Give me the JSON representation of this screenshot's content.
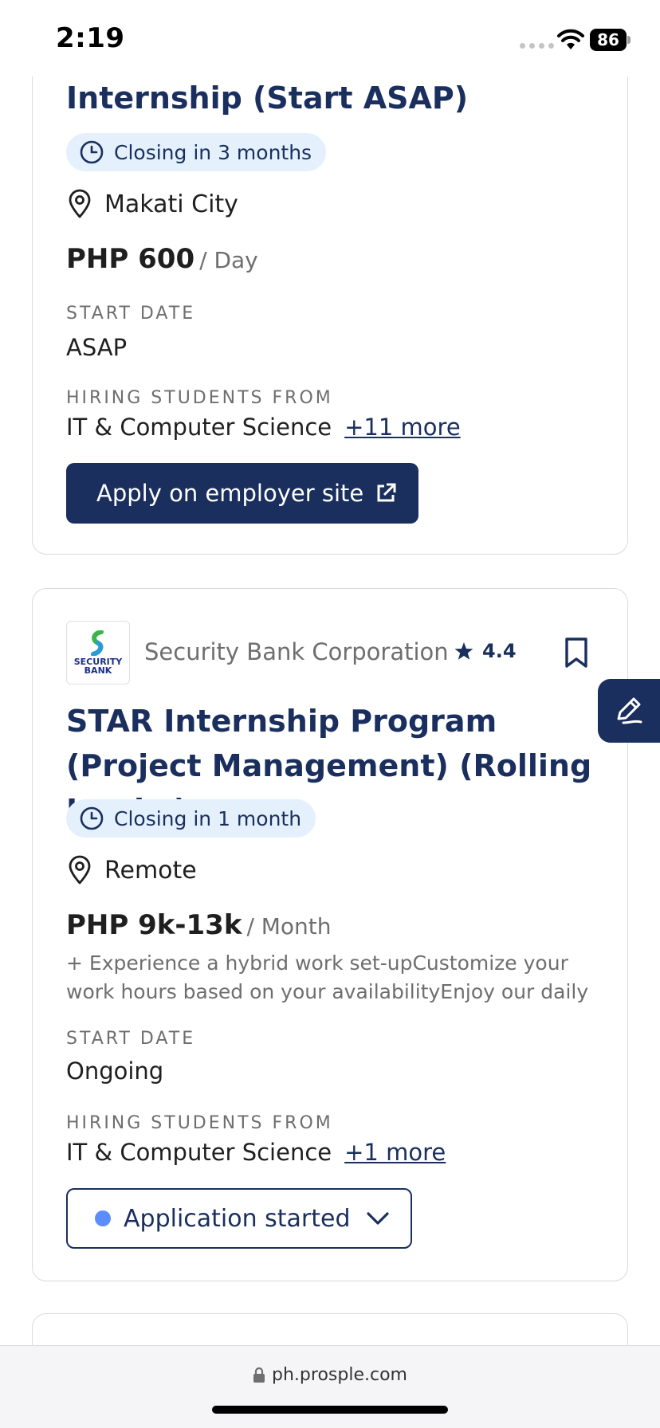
{
  "status_bar": {
    "time": "2:19",
    "battery": "86"
  },
  "listings": [
    {
      "title": "Internship (Start ASAP)",
      "closing": "Closing in 3 months",
      "location": "Makati City",
      "pay": "PHP 600",
      "pay_unit": "/ Day",
      "start_date_label": "START DATE",
      "start_date": "ASAP",
      "hiring_label": "HIRING STUDENTS FROM",
      "hiring_field": "IT & Computer Science",
      "hiring_more": "+11 more",
      "action_label": "Apply on employer site"
    },
    {
      "company": "Security Bank Corporation",
      "company_logo_text": [
        "SECURITY",
        "BANK"
      ],
      "rating": "4.4",
      "title": "STAR Internship Program (Project Management) (Rolling Intake)",
      "closing": "Closing in 1 month",
      "location": "Remote",
      "pay": "PHP 9k-13k",
      "pay_unit": "/ Month",
      "description": "+ Experience a hybrid work set-upCustomize your work hours based on your availabilityEnjoy our daily",
      "start_date_label": "START DATE",
      "start_date": "Ongoing",
      "hiring_label": "HIRING STUDENTS FROM",
      "hiring_field": "IT & Computer Science",
      "hiring_more": "+1 more",
      "status_label": "Application started"
    }
  ],
  "browser": {
    "url": "ph.prosple.com"
  },
  "icons": {
    "clock": "clock-icon",
    "pin": "location-pin-icon",
    "external": "external-link-icon",
    "star": "star-icon",
    "bookmark": "bookmark-icon",
    "edit": "edit-pencil-icon",
    "chevron": "chevron-down-icon",
    "lock": "lock-icon"
  },
  "colors": {
    "navy": "#1a2f5e",
    "pill_bg": "#e4f1fd",
    "status_dot": "#5b8dff"
  }
}
